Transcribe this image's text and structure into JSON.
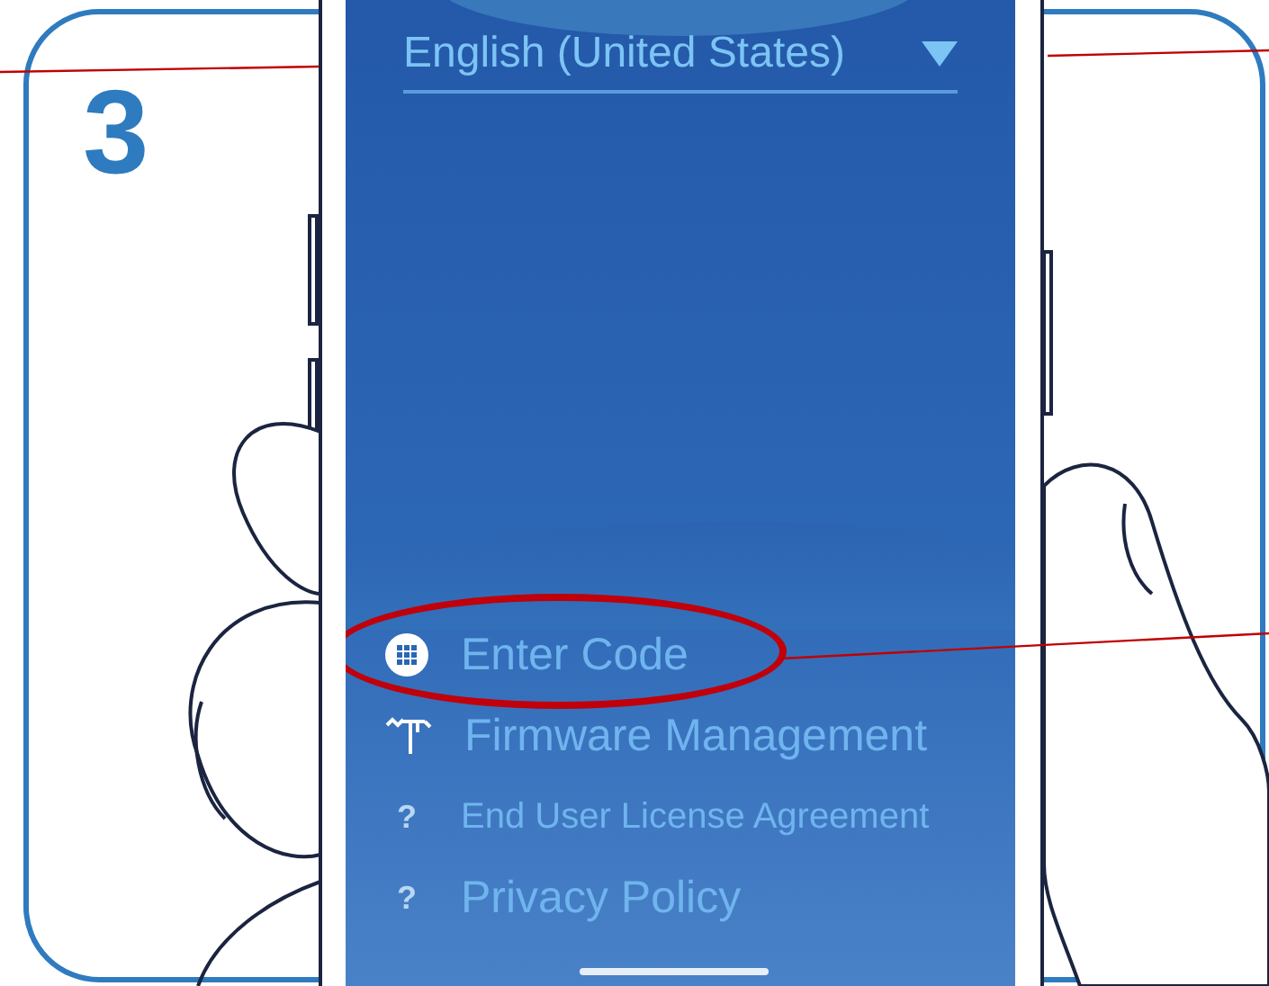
{
  "step": {
    "number": "3"
  },
  "language_select": {
    "value": "English (United States)"
  },
  "menu": [
    {
      "kind": "grid",
      "label": "Enter Code",
      "highlighted": true
    },
    {
      "kind": "tool",
      "label": "Firmware Management",
      "highlighted": false
    },
    {
      "kind": "help",
      "label": "?",
      "text": "End User License Agreement",
      "highlighted": false
    },
    {
      "kind": "help",
      "label": "?",
      "text": "Privacy Policy",
      "highlighted": false
    }
  ]
}
